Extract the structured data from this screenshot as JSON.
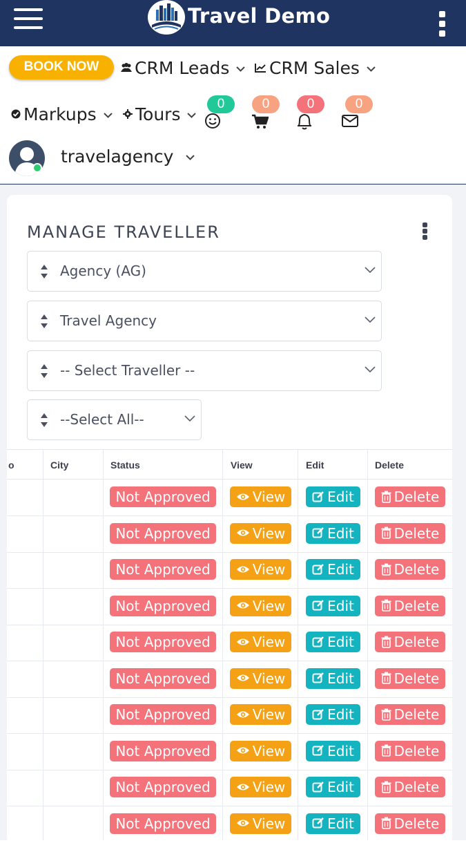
{
  "header": {
    "brand": "Travel Demo",
    "logo_icon": "city-logo-icon",
    "menu_icon": "hamburger-menu-icon",
    "more_icon": "vertical-dots-icon"
  },
  "nav": {
    "book_now": "BOOK NOW",
    "crm_leads": "CRM Leads",
    "crm_sales": "CRM Sales",
    "markups": "Markups",
    "tours": "Tours",
    "badges": {
      "smiley": "0",
      "cart": "0",
      "bell": "0",
      "mail": "0"
    },
    "username": "travelagency"
  },
  "colors": {
    "header_bg": "#1f3461",
    "book_now": "#f8b100",
    "badge_green": "#20c997",
    "badge_orange": "#f7a382",
    "badge_red": "#f4727a",
    "status_not_approved": "#f4727a",
    "view": "#f5a115",
    "edit": "#13b3bf",
    "delete": "#f4727a"
  },
  "card": {
    "title": "MANAGE TRAVELLER",
    "selects": {
      "agency_type": "Agency (AG)",
      "agency": "Travel Agency",
      "traveller": "-- Select Traveller --",
      "filter": "--Select All--"
    }
  },
  "table": {
    "headers": {
      "partial": "o",
      "city": "City",
      "status": "Status",
      "view": "View",
      "edit": "Edit",
      "delete": "Delete"
    },
    "rows": [
      {
        "status": "Not Approved",
        "view": "View",
        "edit": "Edit",
        "delete": "Delete"
      },
      {
        "status": "Not Approved",
        "view": "View",
        "edit": "Edit",
        "delete": "Delete"
      },
      {
        "status": "Not Approved",
        "view": "View",
        "edit": "Edit",
        "delete": "Delete"
      },
      {
        "status": "Not Approved",
        "view": "View",
        "edit": "Edit",
        "delete": "Delete"
      },
      {
        "status": "Not Approved",
        "view": "View",
        "edit": "Edit",
        "delete": "Delete"
      },
      {
        "status": "Not Approved",
        "view": "View",
        "edit": "Edit",
        "delete": "Delete"
      },
      {
        "status": "Not Approved",
        "view": "View",
        "edit": "Edit",
        "delete": "Delete"
      },
      {
        "status": "Not Approved",
        "view": "View",
        "edit": "Edit",
        "delete": "Delete"
      },
      {
        "status": "Not Approved",
        "view": "View",
        "edit": "Edit",
        "delete": "Delete"
      },
      {
        "status": "Not Approved",
        "view": "View",
        "edit": "Edit",
        "delete": "Delete"
      }
    ]
  }
}
